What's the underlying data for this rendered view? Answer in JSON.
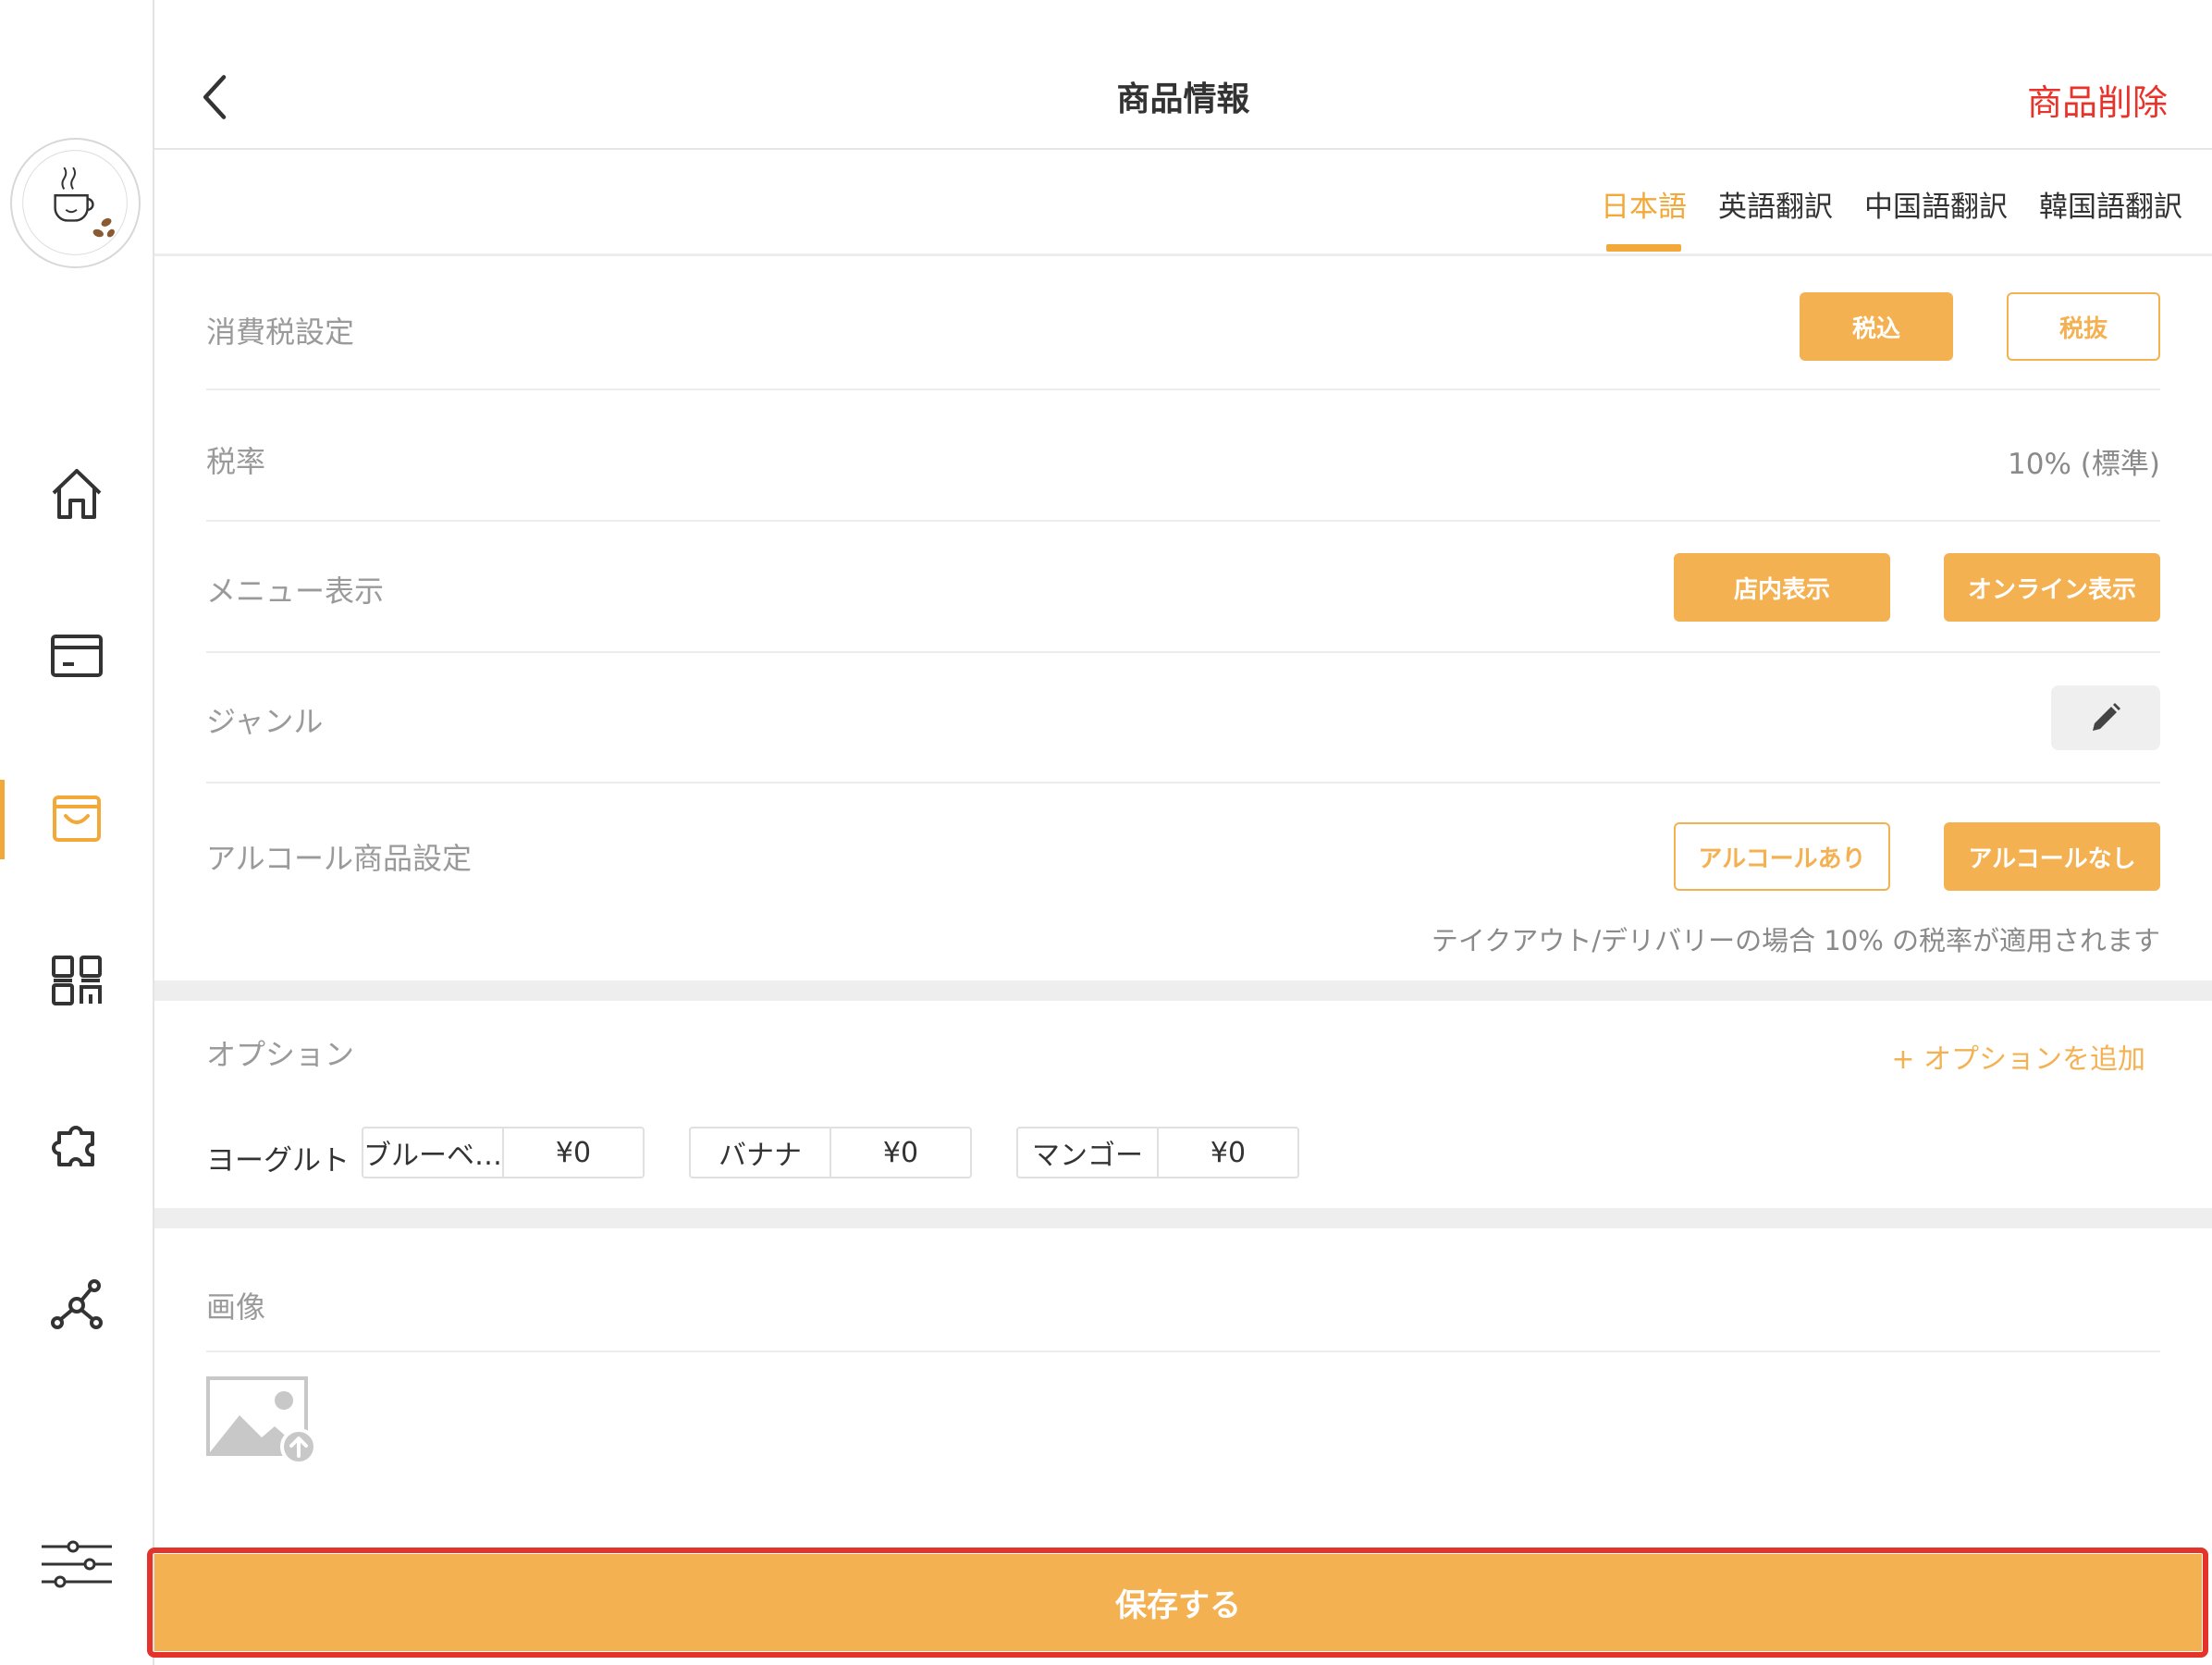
{
  "header": {
    "title": "商品情報",
    "delete_label": "商品削除"
  },
  "lang_tabs": [
    {
      "label": "日本語",
      "active": true
    },
    {
      "label": "英語翻訳",
      "active": false
    },
    {
      "label": "中国語翻訳",
      "active": false
    },
    {
      "label": "韓国語翻訳",
      "active": false
    }
  ],
  "tax_setting": {
    "label": "消費税設定",
    "options": [
      "税込",
      "税抜"
    ],
    "selected": "税込"
  },
  "tax_rate": {
    "label": "税率",
    "value": "10% (標準)"
  },
  "menu_display": {
    "label": "メニュー表示",
    "options": [
      "店内表示",
      "オンライン表示"
    ]
  },
  "genre": {
    "label": "ジャンル",
    "edit_icon": "pencil-icon"
  },
  "alcohol": {
    "label": "アルコール商品設定",
    "options": [
      "アルコールあり",
      "アルコールなし"
    ],
    "selected": "アルコールなし",
    "note": "テイクアウト/デリバリーの場合 10% の税率が適用されます"
  },
  "options_section": {
    "label": "オプション",
    "add_label": "+ オプションを追加",
    "group_name": "ヨーグルト",
    "items": [
      {
        "name": "ブルーベ…",
        "price": "¥0"
      },
      {
        "name": "バナナ",
        "price": "¥0"
      },
      {
        "name": "マンゴー",
        "price": "¥0"
      }
    ]
  },
  "image_section": {
    "label": "画像",
    "upload_icon": "image-upload-icon"
  },
  "save_label": "保存する",
  "colors": {
    "accent": "#f4b152",
    "danger": "#e8332a",
    "highlight_frame": "#e3332a"
  },
  "sidebar": {
    "items": [
      "home-icon",
      "card-icon",
      "shopping-bag-icon",
      "qr-code-icon",
      "puzzle-icon",
      "network-icon",
      "sliders-icon"
    ],
    "active": "shopping-bag-icon"
  }
}
